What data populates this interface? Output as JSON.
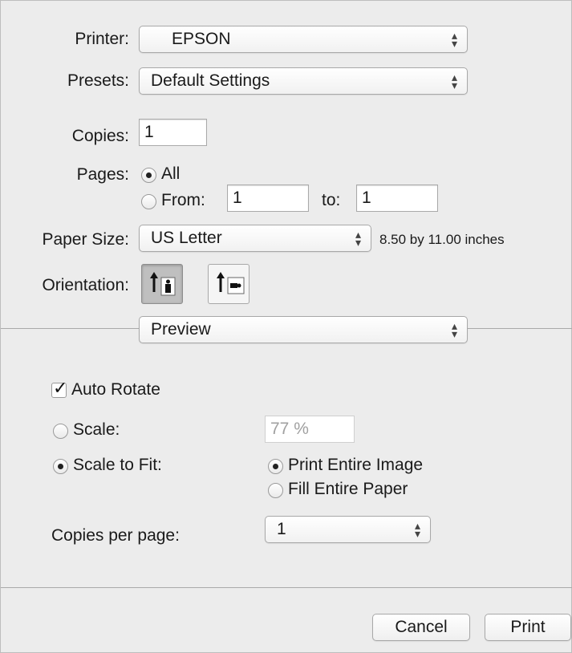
{
  "printer": {
    "label": "Printer:",
    "value": "EPSON"
  },
  "presets": {
    "label": "Presets:",
    "value": "Default Settings"
  },
  "copies": {
    "label": "Copies:",
    "value": "1"
  },
  "pages": {
    "label": "Pages:",
    "all_label": "All",
    "from_label": "From:",
    "from_value": "1",
    "to_label": "to:",
    "to_value": "1",
    "selected": "All"
  },
  "paper_size": {
    "label": "Paper Size:",
    "value": "US Letter",
    "dimensions": "8.50 by 11.00 inches"
  },
  "orientation": {
    "label": "Orientation:",
    "selected": "portrait"
  },
  "section_popup": {
    "value": "Preview"
  },
  "preview": {
    "auto_rotate_label": "Auto Rotate",
    "auto_rotate_checked": true,
    "scale_label": "Scale:",
    "scale_value": "77 %",
    "scale_to_fit_label": "Scale to Fit:",
    "print_entire_image_label": "Print Entire Image",
    "fill_entire_paper_label": "Fill Entire Paper",
    "copies_per_page_label": "Copies per page:",
    "copies_per_page_value": "1"
  },
  "buttons": {
    "cancel": "Cancel",
    "print": "Print"
  }
}
